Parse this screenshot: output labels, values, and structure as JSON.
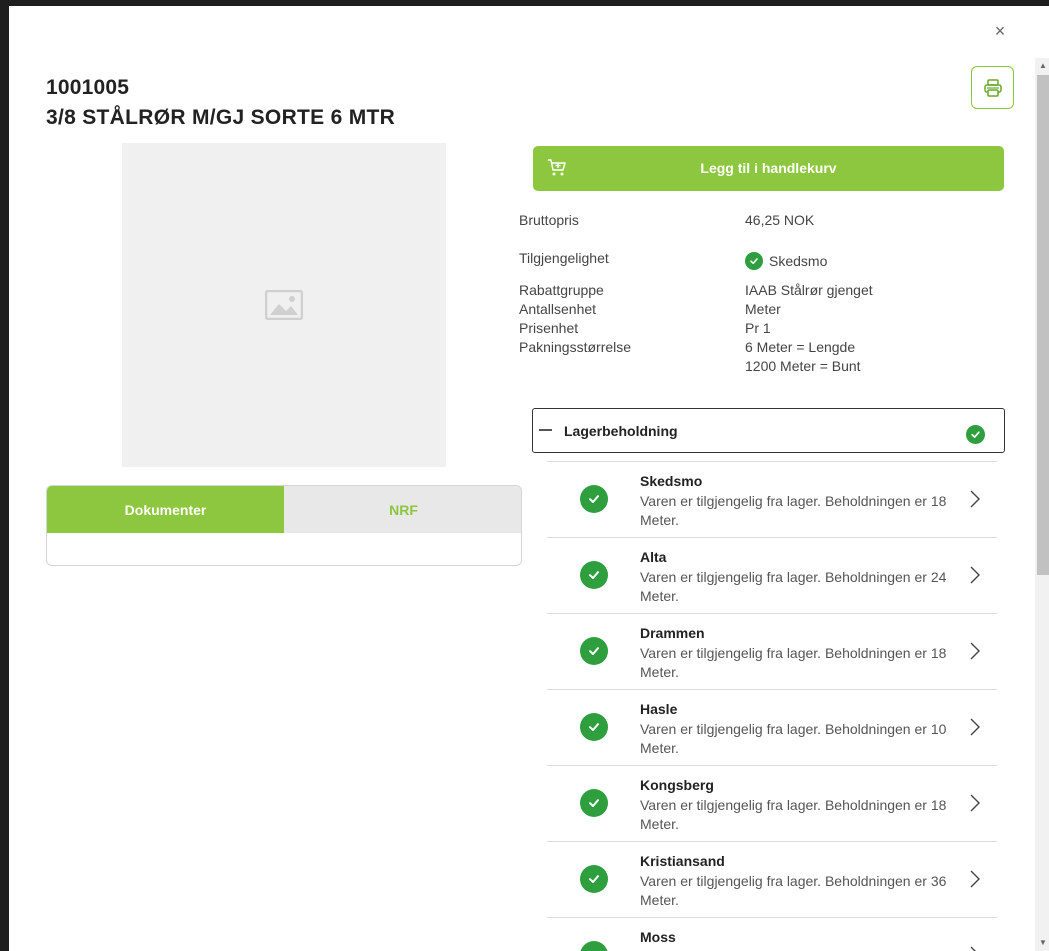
{
  "modal": {
    "close_label": "×"
  },
  "product": {
    "id": "1001005",
    "name": "3/8 STÅLRØR M/GJ SORTE 6 MTR"
  },
  "tabs": [
    {
      "label": "Dokumenter",
      "active": true
    },
    {
      "label": "NRF",
      "active": false
    }
  ],
  "cart_button": {
    "label": "Legg til i handlekurv"
  },
  "details": {
    "bruttopris_label": "Bruttopris",
    "bruttopris_value": "46,25 NOK",
    "availability_label": "Tilgjengelighet",
    "availability_value": "Skedsmo",
    "rabattgruppe_label": "Rabattgruppe",
    "rabattgruppe_value": "IAAB Stålrør gjenget",
    "antallsenhet_label": "Antallsenhet",
    "antallsenhet_value": "Meter",
    "prisenhet_label": "Prisenhet",
    "prisenhet_value": "Pr 1",
    "pakning_label": "Pakningsstørrelse",
    "pakning_value_1": "6 Meter = Lengde",
    "pakning_value_2": "1200 Meter = Bunt"
  },
  "stock": {
    "title": "Lagerbeholdning",
    "locations": [
      {
        "name": "Skedsmo",
        "text": "Varen er tilgjengelig fra lager. Beholdningen er 18 Meter."
      },
      {
        "name": "Alta",
        "text": "Varen er tilgjengelig fra lager. Beholdningen er 24 Meter."
      },
      {
        "name": "Drammen",
        "text": "Varen er tilgjengelig fra lager. Beholdningen er 18 Meter."
      },
      {
        "name": "Hasle",
        "text": "Varen er tilgjengelig fra lager. Beholdningen er 10 Meter."
      },
      {
        "name": "Kongsberg",
        "text": "Varen er tilgjengelig fra lager. Beholdningen er 18 Meter."
      },
      {
        "name": "Kristiansand",
        "text": "Varen er tilgjengelig fra lager. Beholdningen er 36 Meter."
      },
      {
        "name": "Moss",
        "text": ""
      }
    ]
  },
  "colors": {
    "accent": "#8dc63f",
    "status_ok": "#2e9e3e"
  },
  "icons": {
    "close": "close-icon",
    "print": "print-icon",
    "cart": "cart-icon",
    "image_placeholder": "image-placeholder-icon",
    "check": "check-icon",
    "chevron": "chevron-right-icon"
  }
}
